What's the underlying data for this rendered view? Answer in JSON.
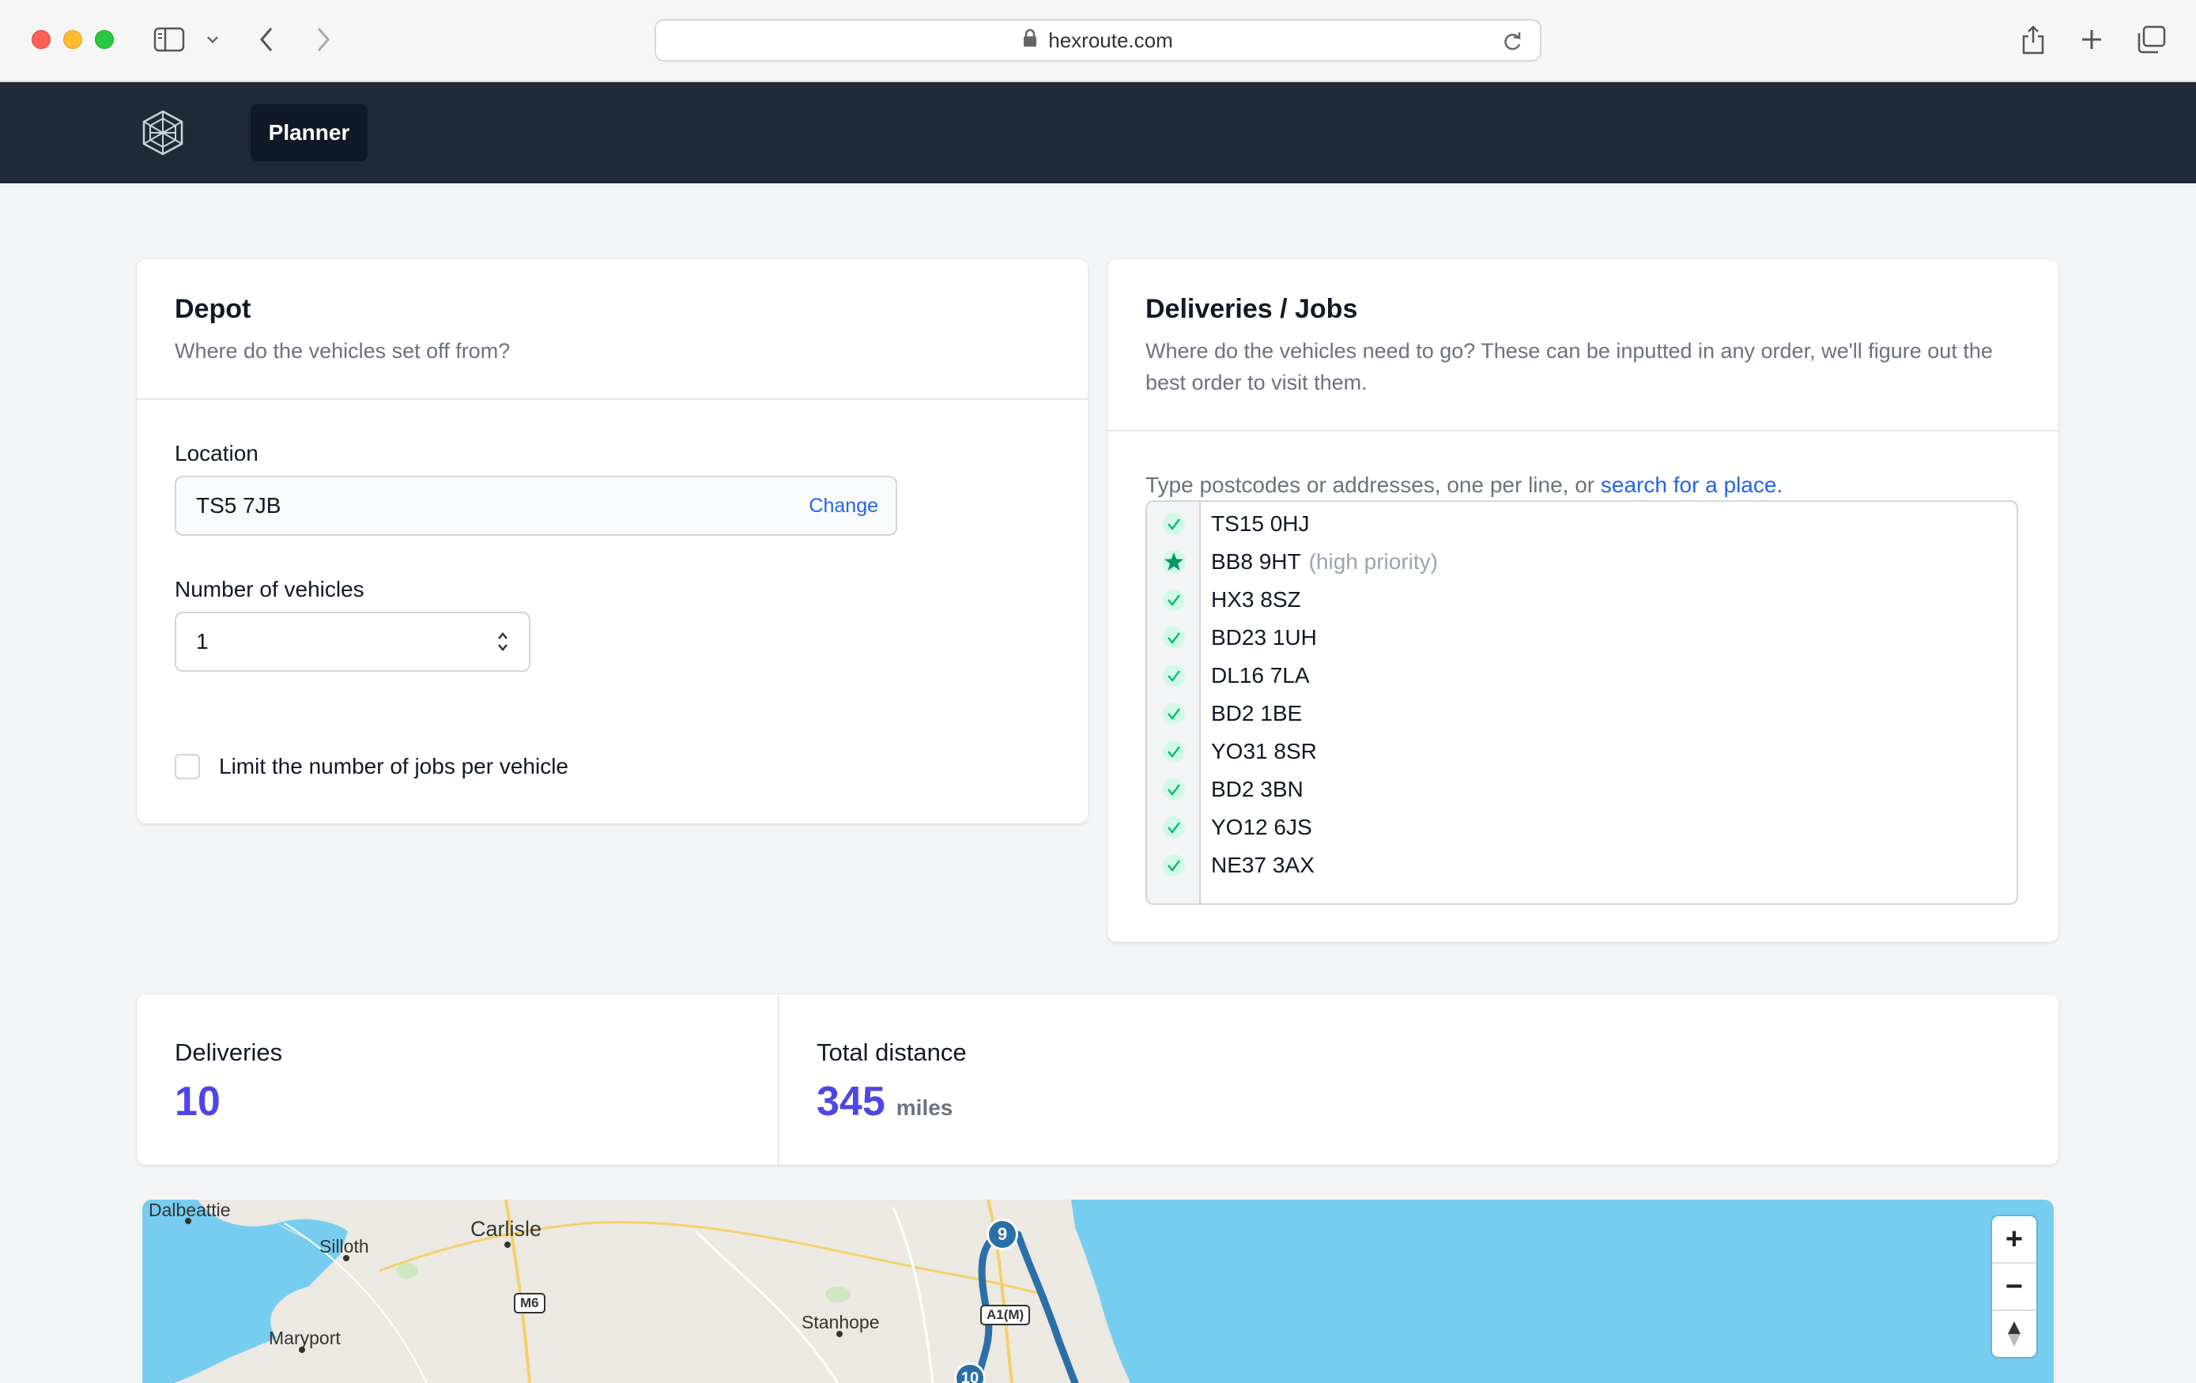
{
  "browser": {
    "url": "hexroute.com"
  },
  "nav": {
    "tab_label": "Planner"
  },
  "depot": {
    "title": "Depot",
    "subtitle": "Where do the vehicles set off from?",
    "location_label": "Location",
    "location_value": "TS5 7JB",
    "change_label": "Change",
    "vehicles_label": "Number of vehicles",
    "vehicles_value": "1",
    "limit_label": "Limit the number of jobs per vehicle"
  },
  "jobs": {
    "title": "Deliveries / Jobs",
    "subtitle": "Where do the vehicles need to go? These can be inputted in any order, we'll figure out the best order to visit them.",
    "instructions_prefix": "Type postcodes or addresses, one per line, or ",
    "instructions_link": "search for a place.",
    "items": [
      {
        "code": "TS15 0HJ",
        "note": "",
        "icon": "check-icon"
      },
      {
        "code": "BB8 9HT",
        "note": "(high priority)",
        "icon": "star-icon"
      },
      {
        "code": "HX3 8SZ",
        "note": "",
        "icon": "check-icon"
      },
      {
        "code": "BD23 1UH",
        "note": "",
        "icon": "check-icon"
      },
      {
        "code": "DL16 7LA",
        "note": "",
        "icon": "check-icon"
      },
      {
        "code": "BD2 1BE",
        "note": "",
        "icon": "check-icon"
      },
      {
        "code": "YO31 8SR",
        "note": "",
        "icon": "check-icon"
      },
      {
        "code": "BD2 3BN",
        "note": "",
        "icon": "check-icon"
      },
      {
        "code": "YO12 6JS",
        "note": "",
        "icon": "check-icon"
      },
      {
        "code": "NE37 3AX",
        "note": "",
        "icon": "check-icon"
      }
    ]
  },
  "stats": {
    "deliveries_label": "Deliveries",
    "deliveries_value": "10",
    "distance_label": "Total distance",
    "distance_value": "345",
    "distance_unit": "miles"
  },
  "map": {
    "places": [
      "Dalbeattie",
      "Silloth",
      "Carlisle",
      "Maryport",
      "Stanhope"
    ],
    "road_labels": [
      "M6",
      "A1(M)"
    ],
    "markers": [
      "9",
      "10"
    ],
    "zoom_in": "+",
    "zoom_out": "−",
    "colors": {
      "sea": "#76cdef",
      "land": "#ece9e2",
      "route": "#2a6fa8"
    }
  }
}
